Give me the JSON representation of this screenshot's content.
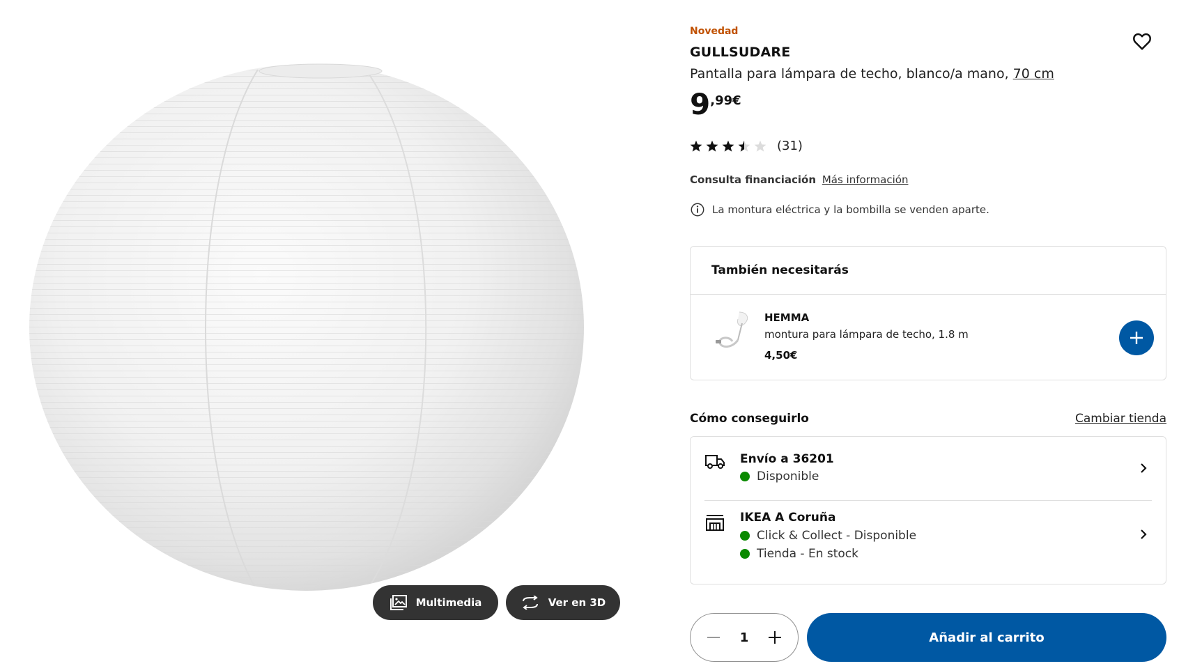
{
  "colors": {
    "accent_blue": "#0058a3",
    "novedad_orange": "#c05000",
    "available_green": "#0a8a00",
    "media_button_dark": "#333333"
  },
  "gallery": {
    "multimedia_label": "Multimedia",
    "view3d_label": "Ver en 3D",
    "multimedia_icon": "gallery-icon",
    "view3d_icon": "rotate-icon"
  },
  "product": {
    "badge": "Novedad",
    "name": "GULLSUDARE",
    "description": "Pantalla para lámpara de techo, blanco/a mano,",
    "size_link": "70 cm",
    "price_integer": "9",
    "price_decimal": ",99€",
    "rating": 3.5,
    "rating_max": 5,
    "rating_count": "(31)",
    "financing_label": "Consulta financiación",
    "financing_link": "Más información",
    "notice": "La montura eléctrica y la bombilla se venden aparte.",
    "favorite_icon": "heart-icon"
  },
  "also_needed": {
    "title": "También necesitarás",
    "item": {
      "name": "HEMMA",
      "description": "montura para lámpara de techo, 1.8 m",
      "price": "4,50€",
      "add_icon": "plus-icon"
    }
  },
  "how_to_get": {
    "title": "Cómo conseguirlo",
    "change_store": "Cambiar tienda",
    "delivery": {
      "icon": "truck-icon",
      "title": "Envío a 36201",
      "status": "Disponible"
    },
    "store": {
      "icon": "store-icon",
      "title": "IKEA A Coruña",
      "status_collect": "Click & Collect - Disponible",
      "status_stock": "Tienda - En stock"
    }
  },
  "purchase": {
    "quantity": "1",
    "add_to_cart": "Añadir al carrito"
  }
}
